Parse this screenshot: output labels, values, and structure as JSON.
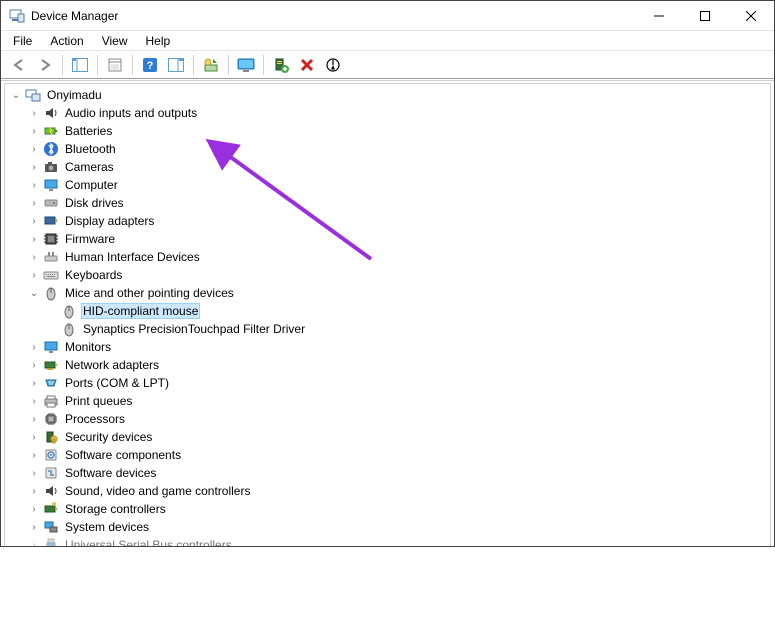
{
  "window": {
    "title": "Device Manager"
  },
  "menu": {
    "file": "File",
    "action": "Action",
    "view": "View",
    "help": "Help"
  },
  "toolbar": {
    "back": "Back",
    "forward": "Forward",
    "show_hide_tree": "Show/Hide Console Tree",
    "properties": "Properties",
    "help": "Help",
    "action_center": "Options",
    "update_driver": "Update Driver",
    "scan_hw": "Scan for hardware changes",
    "add_legacy": "Add legacy hardware",
    "uninstall": "Uninstall device",
    "disable": "Disable device"
  },
  "tree": {
    "root": "Onyimadu",
    "nodes": {
      "audio": "Audio inputs and outputs",
      "batteries": "Batteries",
      "bluetooth": "Bluetooth",
      "cameras": "Cameras",
      "computer": "Computer",
      "disk": "Disk drives",
      "display": "Display adapters",
      "firmware": "Firmware",
      "hid": "Human Interface Devices",
      "keyboards": "Keyboards",
      "mice": "Mice and other pointing devices",
      "mice_children": {
        "hidmouse": "HID-compliant mouse",
        "synaptics": "Synaptics PrecisionTouchpad Filter Driver"
      },
      "monitors": "Monitors",
      "network": "Network adapters",
      "ports": "Ports (COM & LPT)",
      "printq": "Print queues",
      "processors": "Processors",
      "security": "Security devices",
      "swcomp": "Software components",
      "swdev": "Software devices",
      "sound": "Sound, video and game controllers",
      "storage": "Storage controllers",
      "sysdev": "System devices",
      "usb": "Universal Serial Bus controllers"
    }
  }
}
